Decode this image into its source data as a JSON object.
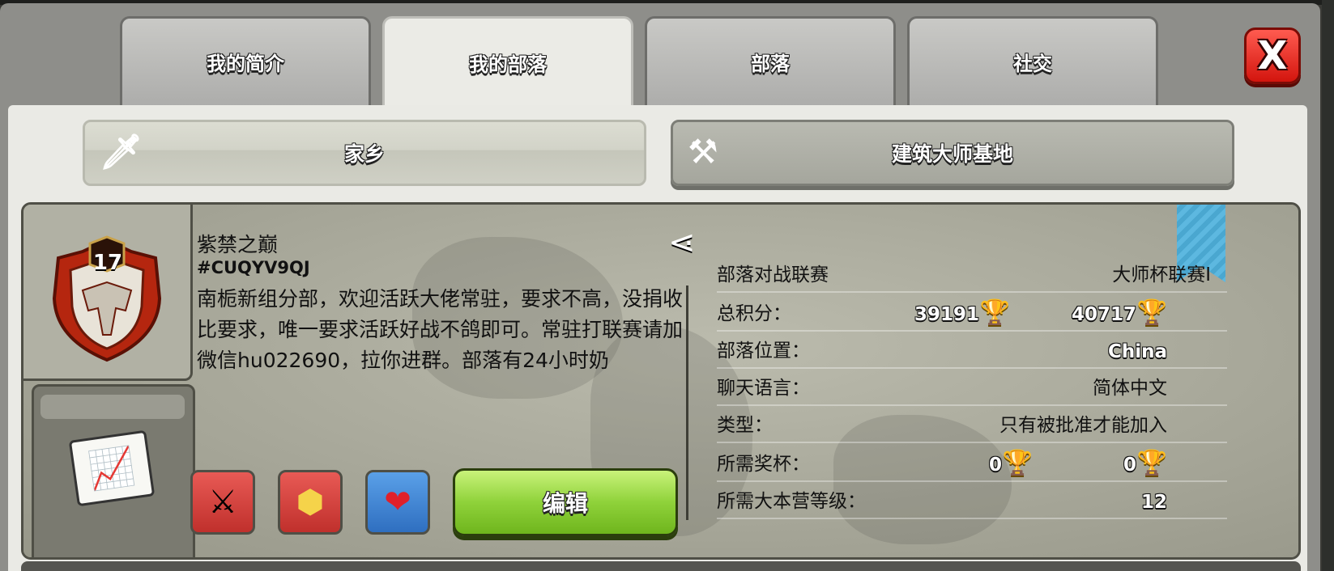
{
  "tabs": [
    {
      "label": "我的简介"
    },
    {
      "label": "我的部落"
    },
    {
      "label": "部落"
    },
    {
      "label": "社交"
    }
  ],
  "close_label": "X",
  "subtabs": {
    "home": "家乡",
    "builder": "建筑大师基地"
  },
  "clan": {
    "level": "17",
    "name": "紫禁之巅",
    "tag": "#CUQYV9QJ",
    "description": "南栀新组分部，欢迎活跃大佬常驻，要求不高，没捐收比要求，唯一要求活跃好战不鸽即可。常驻打联赛请加微信hu022690，拉你进群。部落有24小时奶",
    "edit_label": "编辑"
  },
  "stats": {
    "war_league_label": "部落对战联赛",
    "war_league_value": "大师杯联赛I",
    "points_label": "总积分：",
    "points_home": "39191",
    "points_builder": "40717",
    "location_label": "部落位置：",
    "location_value": "China",
    "language_label": "聊天语言：",
    "language_value": "简体中文",
    "type_label": "类型：",
    "type_value": "只有被批准才能加入",
    "trophies_label": "所需奖杯：",
    "trophies_home": "0",
    "trophies_builder": "0",
    "th_level_label": "所需大本营等级：",
    "th_level_value": "12"
  },
  "icons": {
    "share": "share-icon",
    "sword": "sword-icon",
    "axes": "crossed-axes-icon",
    "trophy": "trophy-icon",
    "graph": "graph-icon",
    "war": "crossed-swords-shield-icon",
    "league": "league-badge-icon",
    "heart": "heart-icon",
    "bookmark": "bookmark-icon"
  },
  "colors": {
    "close_red": "#d3150e",
    "edit_green": "#8fd23a",
    "bookmark_blue": "#5db8e0",
    "trophy_gold": "#f2c200"
  }
}
